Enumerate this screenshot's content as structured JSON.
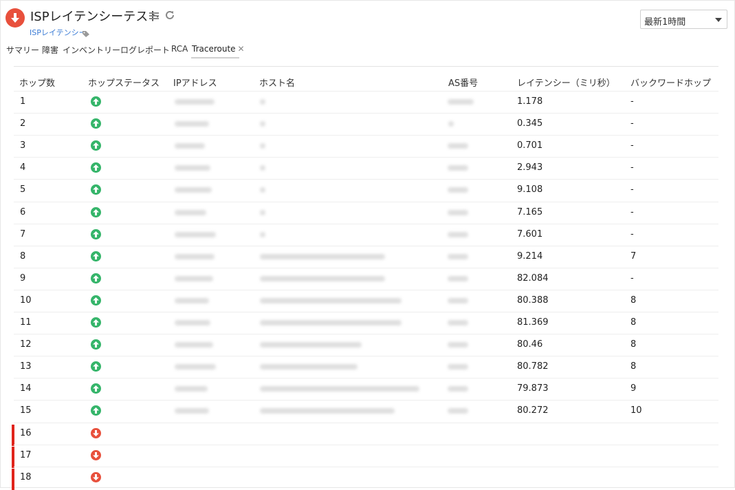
{
  "header": {
    "title": "ISPレイテンシーテスト",
    "subtitle": "ISPレイテンシー",
    "status_color": "#e8503c",
    "time_range": "最新1時間"
  },
  "tabs": [
    {
      "label": "サマリー"
    },
    {
      "label": "障害"
    },
    {
      "label": "インベントリー"
    },
    {
      "label": "ログレポート"
    },
    {
      "label": "RCA"
    },
    {
      "label": "Traceroute",
      "active": true,
      "close_label": "✕"
    }
  ],
  "table": {
    "columns": [
      "ホップ数",
      "ホップステータス",
      "IPアドレス",
      "ホスト名",
      "AS番号",
      "レイテンシー（ミリ秒）",
      "バックワードホップ"
    ],
    "rows": [
      {
        "hop": "1",
        "status": "up",
        "latency": "1.178",
        "backward": "-"
      },
      {
        "hop": "2",
        "status": "up",
        "latency": "0.345",
        "backward": "-"
      },
      {
        "hop": "3",
        "status": "up",
        "latency": "0.701",
        "backward": "-"
      },
      {
        "hop": "4",
        "status": "up",
        "latency": "2.943",
        "backward": "-"
      },
      {
        "hop": "5",
        "status": "up",
        "latency": "9.108",
        "backward": "-"
      },
      {
        "hop": "6",
        "status": "up",
        "latency": "7.165",
        "backward": "-"
      },
      {
        "hop": "7",
        "status": "up",
        "latency": "7.601",
        "backward": "-"
      },
      {
        "hop": "8",
        "status": "up",
        "latency": "9.214",
        "backward": "7"
      },
      {
        "hop": "9",
        "status": "up",
        "latency": "82.084",
        "backward": "-"
      },
      {
        "hop": "10",
        "status": "up",
        "latency": "80.388",
        "backward": "8"
      },
      {
        "hop": "11",
        "status": "up",
        "latency": "81.369",
        "backward": "8"
      },
      {
        "hop": "12",
        "status": "up",
        "latency": "80.46",
        "backward": "8"
      },
      {
        "hop": "13",
        "status": "up",
        "latency": "80.782",
        "backward": "8"
      },
      {
        "hop": "14",
        "status": "up",
        "latency": "79.873",
        "backward": "9"
      },
      {
        "hop": "15",
        "status": "up",
        "latency": "80.272",
        "backward": "10"
      },
      {
        "hop": "16",
        "status": "down",
        "latency": "",
        "backward": ""
      },
      {
        "hop": "17",
        "status": "down",
        "latency": "",
        "backward": ""
      },
      {
        "hop": "18",
        "status": "down",
        "latency": "",
        "backward": ""
      }
    ]
  },
  "colors": {
    "up": "#35b56a",
    "down": "#e8503c",
    "accent": "#3a7bd5",
    "failed_bar": "#e0241b"
  }
}
